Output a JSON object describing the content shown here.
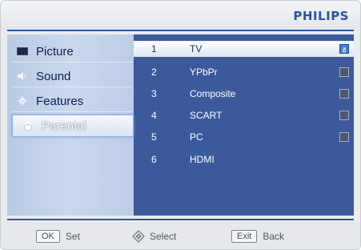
{
  "brand": "PHILIPS",
  "sidebar": {
    "items": [
      {
        "label": "Picture",
        "icon": "monitor-icon"
      },
      {
        "label": "Sound",
        "icon": "speaker-icon"
      },
      {
        "label": "Features",
        "icon": "gear-icon"
      },
      {
        "label": "Parental",
        "icon": "lock-icon",
        "selected": true
      }
    ]
  },
  "list": {
    "rows": [
      {
        "number": "1",
        "name": "TV",
        "highlighted": true,
        "lock_mark": "ᵹ"
      },
      {
        "number": "2",
        "name": "YPbPr"
      },
      {
        "number": "3",
        "name": "Composite"
      },
      {
        "number": "4",
        "name": "SCART"
      },
      {
        "number": "5",
        "name": "PC"
      },
      {
        "number": "6",
        "name": "HDMI"
      }
    ]
  },
  "footer": {
    "ok_key": "OK",
    "ok_label": "Set",
    "select_label": "Select",
    "exit_key": "Exit",
    "exit_label": "Back"
  },
  "colors": {
    "brand": "#2a55a4",
    "panel": "#3b5a9c",
    "sidebar": "#c9d8ec"
  }
}
